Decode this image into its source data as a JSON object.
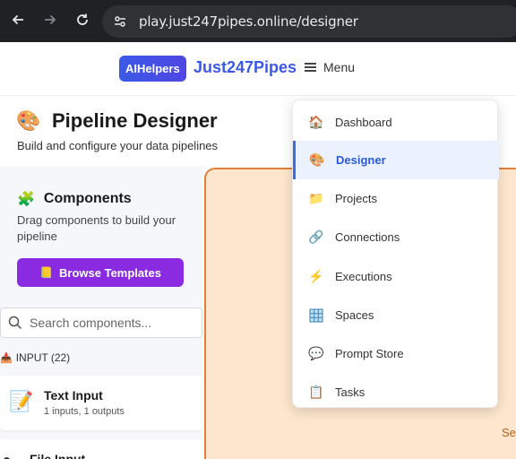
{
  "browser": {
    "url": "play.just247pipes.online/designer"
  },
  "header": {
    "badge": "AIHelpers",
    "brand": "Just247Pipes",
    "menu_label": "Menu"
  },
  "page": {
    "title": "Pipeline Designer",
    "subtitle": "Build and configure your data pipelines"
  },
  "sidebar": {
    "title": "Components",
    "description": "Drag components to build your pipeline",
    "browse_button": "Browse Templates",
    "search_placeholder": "Search components...",
    "section": "INPUT (22)",
    "components": [
      {
        "name": "Text Input",
        "meta": "1 inputs, 1 outputs"
      },
      {
        "name": "File Input"
      }
    ]
  },
  "canvas": {
    "hint": "Sel"
  },
  "menu": {
    "items": [
      {
        "label": "Dashboard",
        "icon": "house-icon"
      },
      {
        "label": "Designer",
        "icon": "palette-icon",
        "active": true
      },
      {
        "label": "Projects",
        "icon": "folder-icon"
      },
      {
        "label": "Connections",
        "icon": "link-icon"
      },
      {
        "label": "Executions",
        "icon": "lightning-icon"
      },
      {
        "label": "Spaces",
        "icon": "grid-icon"
      },
      {
        "label": "Prompt Store",
        "icon": "chat-icon"
      },
      {
        "label": "Tasks",
        "icon": "clipboard-icon"
      }
    ]
  },
  "colors": {
    "brand": "#3b59e6",
    "browse_button": "#8a2be2",
    "canvas_border": "#e2803a",
    "canvas_bg": "#fde6cd",
    "active_menu_bg": "#ecf2fd"
  }
}
